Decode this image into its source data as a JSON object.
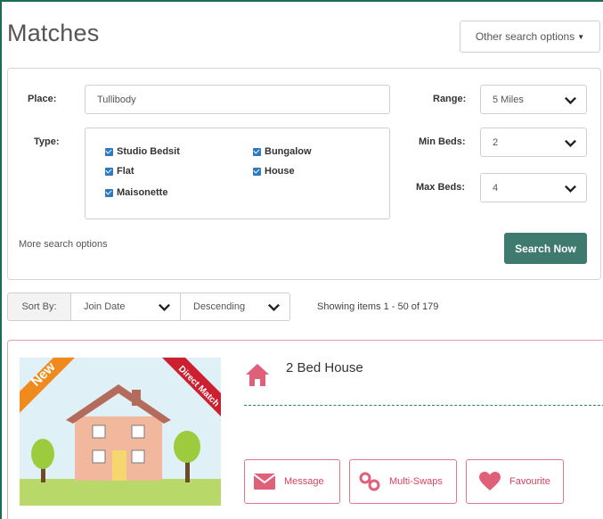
{
  "page": {
    "title": "Matches",
    "other_search_options": "Other search options"
  },
  "search": {
    "place_label": "Place:",
    "place_value": "Tullibody",
    "type_label": "Type:",
    "types": [
      {
        "label": "Studio Bedsit",
        "checked": true
      },
      {
        "label": "Flat",
        "checked": true
      },
      {
        "label": "Maisonette",
        "checked": true
      },
      {
        "label": "Bungalow",
        "checked": true
      },
      {
        "label": "House",
        "checked": true
      }
    ],
    "range_label": "Range:",
    "range_value": "5 Miles",
    "min_beds_label": "Min Beds:",
    "min_beds_value": "2",
    "max_beds_label": "Max Beds:",
    "max_beds_value": "4",
    "more_options": "More search options",
    "search_button": "Search Now"
  },
  "sort": {
    "label": "Sort By:",
    "field": "Join Date",
    "order": "Descending",
    "showing": "Showing items 1 - 50 of 179"
  },
  "listing": {
    "badge_new": "New",
    "badge_match": "Direct Match",
    "title": "2 Bed House",
    "icon": "home-icon",
    "actions": [
      {
        "label": "Message",
        "icon": "envelope-icon"
      },
      {
        "label": "Multi-Swaps",
        "icon": "link-icon"
      },
      {
        "label": "Favourite",
        "icon": "heart-icon"
      }
    ]
  },
  "colors": {
    "accent_green": "#3e7a6e",
    "checkbox_blue": "#2f78c2",
    "pink": "#d9435f",
    "badge_orange": "#f08a1d",
    "badge_red": "#cc1f2f"
  }
}
